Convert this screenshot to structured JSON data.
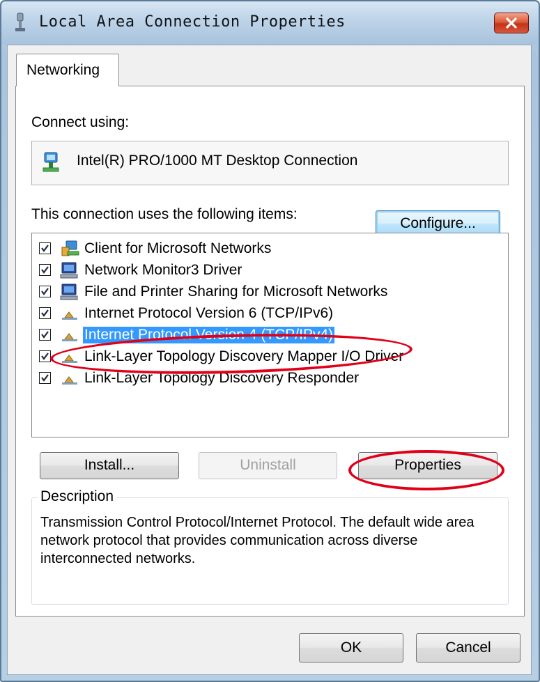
{
  "window": {
    "title": "Local Area Connection Properties"
  },
  "tabs": [
    {
      "label": "Networking"
    }
  ],
  "connect_using": {
    "label": "Connect using:",
    "adapter": "Intel(R) PRO/1000 MT Desktop Connection"
  },
  "buttons": {
    "configure": "Configure...",
    "install": "Install...",
    "uninstall": "Uninstall",
    "properties": "Properties",
    "ok": "OK",
    "cancel": "Cancel"
  },
  "items_label": "This connection uses the following items:",
  "items": [
    {
      "label": "Client for Microsoft Networks",
      "checked": true,
      "icon": "network-client-icon"
    },
    {
      "label": "Network Monitor3 Driver",
      "checked": true,
      "icon": "computer-service-icon"
    },
    {
      "label": "File and Printer Sharing for Microsoft Networks",
      "checked": true,
      "icon": "computer-service-icon"
    },
    {
      "label": "Internet Protocol Version 6 (TCP/IPv6)",
      "checked": true,
      "icon": "protocol-icon"
    },
    {
      "label": "Internet Protocol Version 4 (TCP/IPv4)",
      "checked": true,
      "icon": "protocol-icon",
      "selected": true
    },
    {
      "label": "Link-Layer Topology Discovery Mapper I/O Driver",
      "checked": true,
      "icon": "protocol-icon"
    },
    {
      "label": "Link-Layer Topology Discovery Responder",
      "checked": true,
      "icon": "protocol-icon"
    }
  ],
  "description": {
    "legend": "Description",
    "text": "Transmission Control Protocol/Internet Protocol. The default wide area network protocol that provides communication across diverse interconnected networks."
  },
  "colors": {
    "selection": "#3399ff",
    "annotation": "#e0001a",
    "close_button": "#c3331a"
  }
}
